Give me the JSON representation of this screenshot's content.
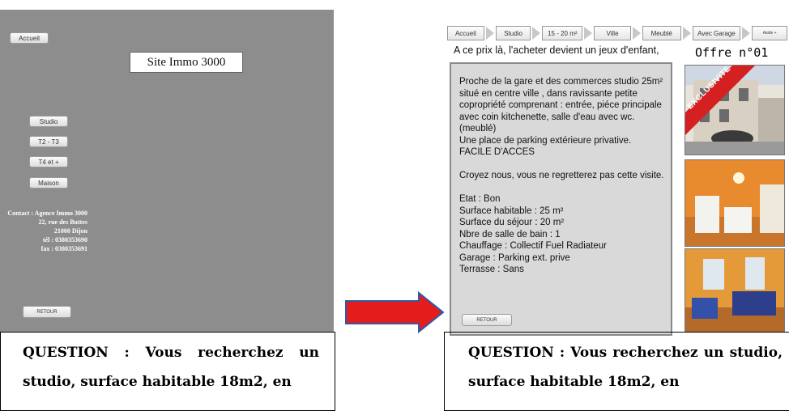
{
  "left": {
    "home_button": "Accueil",
    "site_title": "Site Immo 3000",
    "menu": [
      "Studio",
      "T2 - T3",
      "T4 et +",
      "Maison"
    ],
    "contact": [
      "Contact : Agence Immo 3000",
      "22, rue des Buttes",
      "21000 Dijon",
      "tél : 0380353690",
      "fax : 0380353691"
    ],
    "back_button": "RETOUR"
  },
  "right": {
    "breadcrumb": [
      "Accueil",
      "Studio",
      "15 - 20 m²",
      "Ville",
      "Meublé",
      "Avec Garage",
      "Aside +"
    ],
    "tagline": "A ce prix là, l'acheter devient un jeux d'enfant,",
    "offer_title": "Offre n°01",
    "description": "Proche de la gare et des commerces studio 25m² situé en centre ville , dans ravissante petite copropriété comprenant : entrée, piéce principale avec coin kitchenette, salle d'eau avec wc. (meublé)\nUne place de parking extérieure privative.\nFACILE D'ACCES\n\nCroyez nous, vous ne regretterez pas cette visite.\n\nEtat : Bon\nSurface habitable : 25 m²\nSurface du séjour : 20 m²\nNbre de salle de bain : 1\nChauffage : Collectif Fuel Radiateur\nGarage : Parking ext. prive\nTerrasse : Sans",
    "badge": "EXCLUSIVITE",
    "back_button": "RETOUR"
  },
  "question": {
    "label": "QUESTION : Vous recherchez un studio, surface habitable 18m2, en"
  },
  "colors": {
    "left_bg": "#8d8d8d",
    "arrow": "#e41c1c",
    "arrow_outline": "#2a5ca8"
  }
}
